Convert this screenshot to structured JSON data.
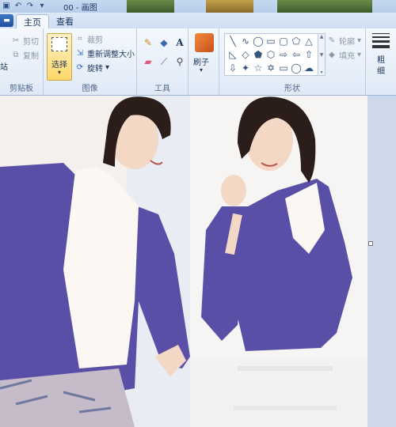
{
  "titlebar": {
    "title": "00 - 画图",
    "qat_icons": [
      "save-icon",
      "undo-icon",
      "redo-icon",
      "dropdown-icon"
    ]
  },
  "tabs": [
    {
      "label": "主页",
      "active": true
    },
    {
      "label": "查看",
      "active": false
    }
  ],
  "ribbon": {
    "clipboard": {
      "label": "剪贴板",
      "paste_label": "站",
      "cut_label": "剪切",
      "copy_label": "复制"
    },
    "image": {
      "label": "图像",
      "select_label": "选择",
      "crop_label": "裁剪",
      "resize_label": "重新调整大小",
      "rotate_label": "旋转"
    },
    "tools": {
      "label": "工具",
      "items": [
        "pencil-icon",
        "fill-icon",
        "text-icon",
        "eraser-icon",
        "color-picker-icon",
        "magnifier-icon"
      ]
    },
    "brush": {
      "label": "刷子"
    },
    "shapes": {
      "label": "形状",
      "outline_label": "轮廓",
      "fill_label": "填充"
    },
    "size": {
      "label": "粗细"
    }
  },
  "colors": {
    "accent": "#1f4f9a",
    "ribbon_bg": "#dfe9f6",
    "select_highlight": "#ffd86b",
    "cardigan": "#5a4fa6"
  }
}
